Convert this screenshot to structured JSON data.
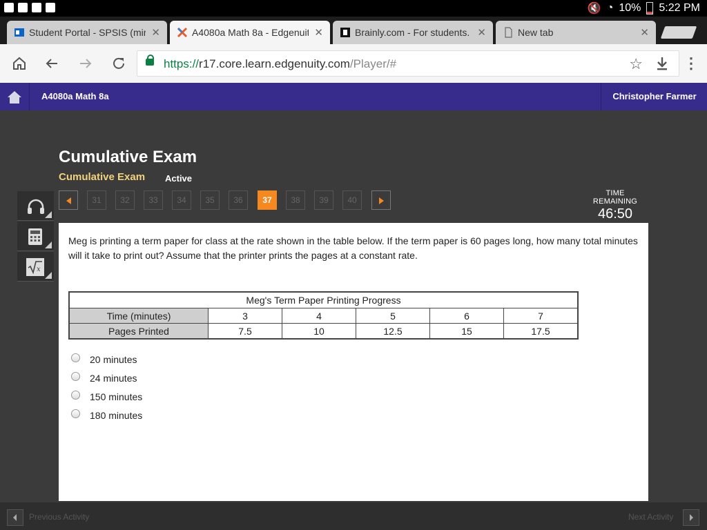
{
  "status_bar": {
    "battery": "10%",
    "time": "5:22 PM"
  },
  "tabs": [
    {
      "title": "Student Portal - SPSIS (miru",
      "close": "✕"
    },
    {
      "title": "A4080a Math 8a - Edgenuity",
      "close": "✕"
    },
    {
      "title": "Brainly.com - For students.",
      "close": "✕"
    },
    {
      "title": "New tab",
      "close": "✕"
    }
  ],
  "address_bar": {
    "scheme": "https://",
    "host": "r17.core.learn.edgenuity.com",
    "path": "/Player/#"
  },
  "app_header": {
    "course": "A4080a Math 8a",
    "user": "Christopher Farmer"
  },
  "exam": {
    "title": "Cumulative Exam",
    "subtitle": "Cumulative Exam",
    "status": "Active"
  },
  "pager": {
    "pages": [
      "31",
      "32",
      "33",
      "34",
      "35",
      "36",
      "37",
      "38",
      "39",
      "40"
    ],
    "current": "37"
  },
  "timer": {
    "label": "TIME REMAINING",
    "value": "46:50"
  },
  "question": {
    "text": "Meg is printing a term paper for class at the rate shown in the table below. If the term paper is 60 pages long, how many total minutes will it take to print out? Assume that the printer prints the pages at a constant rate.",
    "table": {
      "caption": "Meg's Term Paper Printing Progress",
      "rows": [
        {
          "label": "Time (minutes)",
          "values": [
            "3",
            "4",
            "5",
            "6",
            "7"
          ]
        },
        {
          "label": "Pages Printed",
          "values": [
            "7.5",
            "10",
            "12.5",
            "15",
            "17.5"
          ]
        }
      ]
    },
    "choices": [
      "20 minutes",
      "24 minutes",
      "150 minutes",
      "180 minutes"
    ]
  },
  "bottom_nav": {
    "prev": "Previous Activity",
    "next": "Next Activity"
  },
  "colors": {
    "header_purple": "#372b8c",
    "accent_orange": "#f5881f",
    "subtitle_gold": "#f2d27a"
  }
}
